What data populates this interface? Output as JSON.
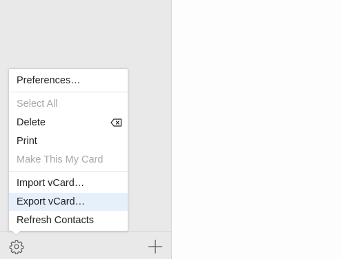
{
  "menu": {
    "items": [
      {
        "label": "Preferences…"
      },
      {
        "label": "Select All"
      },
      {
        "label": "Delete",
        "shortcut_icon": "delete-key-icon"
      },
      {
        "label": "Print"
      },
      {
        "label": "Make This My Card"
      },
      {
        "label": "Import vCard…"
      },
      {
        "label": "Export vCard…"
      },
      {
        "label": "Refresh Contacts"
      }
    ]
  },
  "footer": {
    "settings_icon": "gear-icon",
    "add_icon": "plus-icon"
  },
  "colors": {
    "sidebar_background": "#e9e9ea",
    "menu_highlight": "#e5f0fb",
    "disabled_text": "#a8a8aa"
  }
}
